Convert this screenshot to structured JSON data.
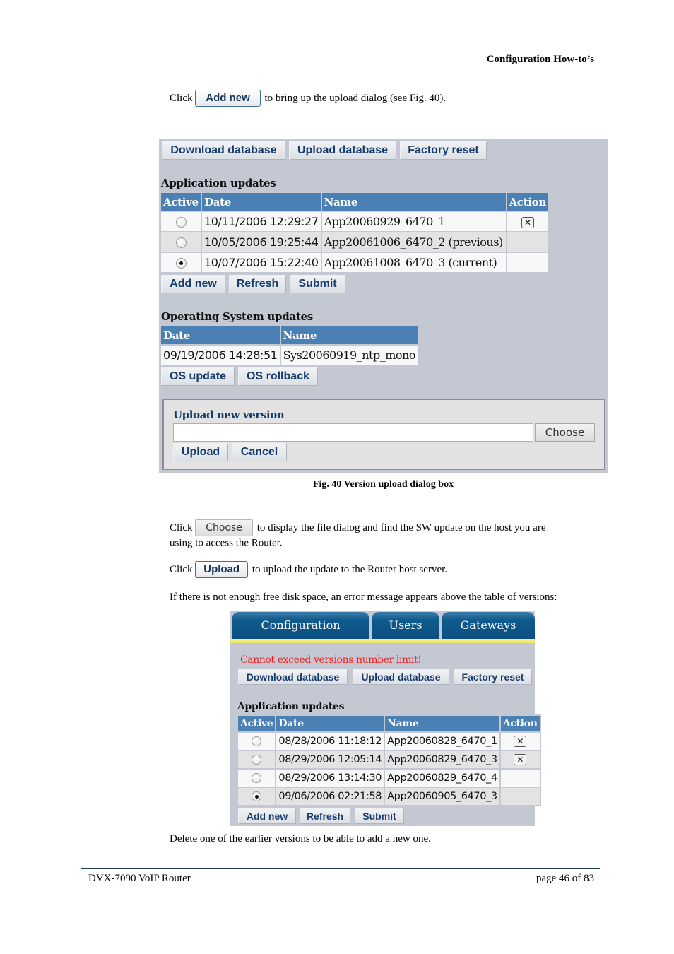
{
  "page": {
    "running_head": "Configuration How-to’s",
    "footer_left": "DVX-7090 VoIP Router",
    "footer_right": "page 46 of 83"
  },
  "paragraphs": {
    "p1_before": "Click",
    "p1_button": "Add new",
    "p1_after": "to bring up the upload dialog (see Fig. 40).",
    "p2_before": "Click",
    "p2_button": "Choose",
    "p2_after": "to display the file dialog and find the SW update on the host you are",
    "p2_line2": "using to access the Router.",
    "p3_before": "Click",
    "p3_button": "Upload",
    "p3_after": "to upload the update to the Router host server.",
    "p4": "If there is not enough free disk space, an error message appears above the table of versions:",
    "p5": "Delete one of the earlier versions to be able to add a new one."
  },
  "figure40": {
    "caption": "Fig. 40 Version upload dialog box",
    "toolbar": [
      "Download database",
      "Upload database",
      "Factory reset"
    ],
    "app_updates": {
      "title": "Application updates",
      "columns": [
        "Active",
        "Date",
        "Name",
        "Action"
      ],
      "rows": [
        {
          "active": false,
          "date": "10/11/2006 12:29:27",
          "name": "App20060929_6470_1",
          "deletable": true
        },
        {
          "active": false,
          "date": "10/05/2006 19:25:44",
          "name": "App20061006_6470_2 (previous)",
          "deletable": false
        },
        {
          "active": true,
          "date": "10/07/2006 15:22:40",
          "name": "App20061008_6470_3 (current)",
          "deletable": false
        }
      ],
      "buttons": [
        "Add new",
        "Refresh",
        "Submit"
      ]
    },
    "os_updates": {
      "title": "Operating System updates",
      "columns": [
        "Date",
        "Name"
      ],
      "rows": [
        {
          "date": "09/19/2006 14:28:51",
          "name": "Sys20060919_ntp_mono"
        }
      ],
      "buttons": [
        "OS update",
        "OS rollback"
      ]
    },
    "upload": {
      "title": "Upload new version",
      "file_value": "",
      "choose_label": "Choose",
      "upload_label": "Upload",
      "cancel_label": "Cancel"
    }
  },
  "figure_error": {
    "tabs": [
      "Configuration",
      "Users",
      "Gateways"
    ],
    "error_message": "Cannot exceed versions number limit!",
    "toolbar": [
      "Download database",
      "Upload database",
      "Factory reset"
    ],
    "app_updates": {
      "title": "Application updates",
      "columns": [
        "Active",
        "Date",
        "Name",
        "Action"
      ],
      "rows": [
        {
          "active": false,
          "date": "08/28/2006 11:18:12",
          "name": "App20060828_6470_1",
          "deletable": true
        },
        {
          "active": false,
          "date": "08/29/2006 12:05:14",
          "name": "App20060829_6470_3",
          "deletable": true
        },
        {
          "active": false,
          "date": "08/29/2006 13:14:30",
          "name": "App20060829_6470_4",
          "deletable": false
        },
        {
          "active": true,
          "date": "09/06/2006 02:21:58",
          "name": "App20060905_6470_3",
          "deletable": false
        }
      ],
      "buttons": [
        "Add new",
        "Refresh",
        "Submit"
      ]
    }
  },
  "icons": {
    "delete": "✕"
  }
}
